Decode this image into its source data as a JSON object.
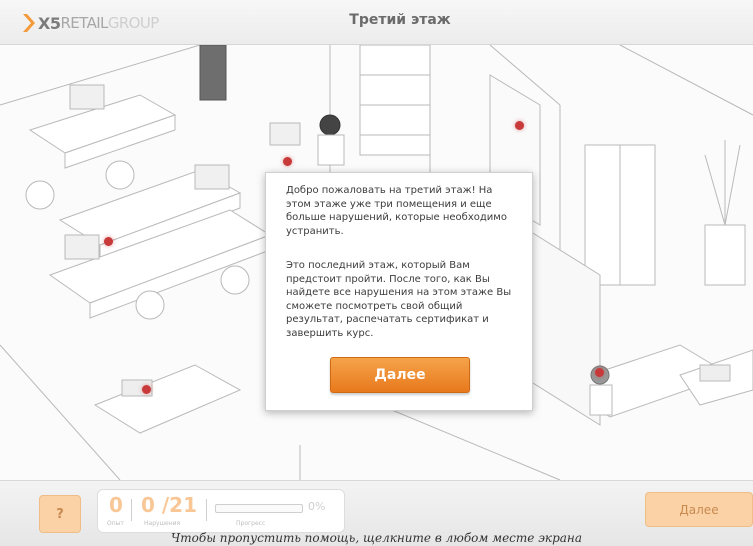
{
  "header": {
    "logo_x5": "X5",
    "logo_retail": "RETAIL",
    "logo_group": "GROUP",
    "title": "Третий этаж"
  },
  "modal": {
    "paragraph1": "Добро пожаловать на третий этаж! На этом этаже уже три помещения и еще больше нарушений, которые необходимо устранить.",
    "paragraph2": "Это последний этаж, который Вам предстоит пройти. После того, как Вы найдете все нарушения на этом этаже Вы сможете посмотреть свой общий результат, распечатать сертификат и завершить курс.",
    "button_label": "Далее"
  },
  "footer": {
    "help_label": "?",
    "experience_value": "0",
    "experience_label": "Опыт",
    "violations_value": "0 /21",
    "violations_label": "Нарушения",
    "progress_label": "Прогресс",
    "progress_value": 0,
    "progress_text": "0%",
    "next_label": "Далее",
    "skip_hint": "Чтобы пропустить помощь, щелкните в любом месте экрана"
  },
  "colors": {
    "accent": "#e8791c",
    "marker": "#c83a3a",
    "disabled_orange": "#fad2a5"
  }
}
